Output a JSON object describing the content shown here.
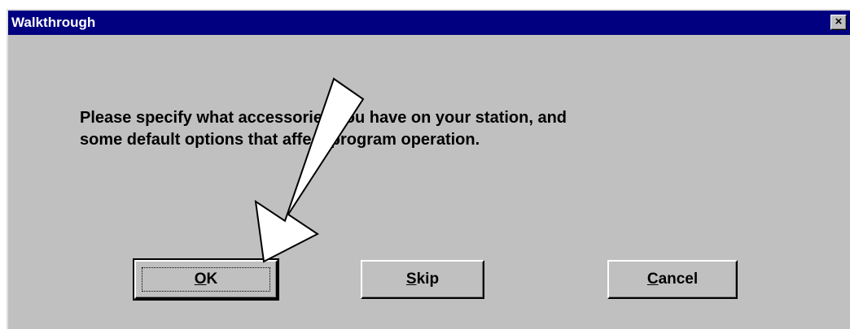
{
  "window": {
    "title": "Walkthrough",
    "close_glyph": "×"
  },
  "message": {
    "line1": "Please specify what accessories you have on your station, and",
    "line2": "some default options that affect program operation."
  },
  "buttons": {
    "ok": {
      "mnemonic": "O",
      "rest": "K"
    },
    "skip": {
      "mnemonic": "S",
      "rest": "kip"
    },
    "cancel": {
      "mnemonic": "C",
      "rest": "ancel"
    }
  },
  "overlay": {
    "icon": "arrow-pointer-icon",
    "color": "#ffffff"
  }
}
